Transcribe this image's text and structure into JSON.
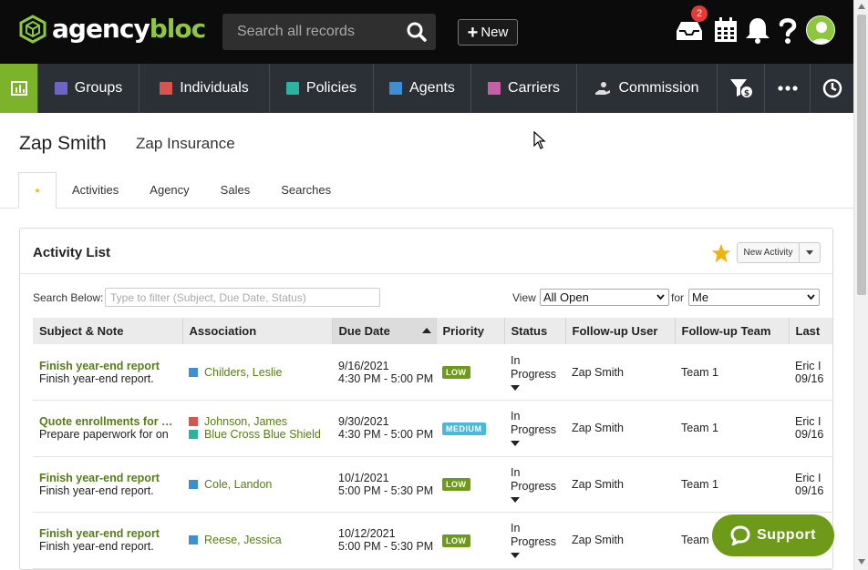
{
  "brand": {
    "name_part1": "agency",
    "name_part2": "bloc",
    "accent": "#8dc63f"
  },
  "topbar": {
    "search_placeholder": "Search all records",
    "new_label": "New",
    "inbox_count": "2",
    "icons": [
      "inbox-icon",
      "calendar-icon",
      "bell-icon",
      "help-icon",
      "user-avatar"
    ]
  },
  "nav": {
    "items": [
      {
        "label": "Groups",
        "color": "#6e63c7"
      },
      {
        "label": "Individuals",
        "color": "#d9534f"
      },
      {
        "label": "Policies",
        "color": "#2bb3a0"
      },
      {
        "label": "Agents",
        "color": "#3d8fd1"
      },
      {
        "label": "Carriers",
        "color": "#c65fa6"
      },
      {
        "label": "Commission",
        "color": "#cfcfcf"
      }
    ]
  },
  "record": {
    "name": "Zap Smith",
    "company": "Zap Insurance"
  },
  "tabs": [
    "Activities",
    "Agency",
    "Sales",
    "Searches"
  ],
  "activity": {
    "title": "Activity List",
    "new_activity": "New Activity",
    "search_label": "Search Below:",
    "filter_placeholder": "Type to filter (Subject, Due Date, Status)",
    "view_label": "View",
    "view_value": "All Open",
    "for_label": "for",
    "for_value": "Me",
    "columns": [
      "Subject & Note",
      "Association",
      "Due Date",
      "Priority",
      "Status",
      "Follow-up User",
      "Follow-up Team",
      "Last"
    ],
    "rows": [
      {
        "subject": "Finish year-end report",
        "note": "Finish year-end report.",
        "assoc": [
          {
            "name": "Childers, Leslie",
            "color": "#3d8fd1"
          }
        ],
        "date": "9/16/2021",
        "time": "4:30 PM - 5:00 PM",
        "priority": "LOW",
        "priority_color": "#6e9a1a",
        "status1": "In",
        "status2": "Progress",
        "user": "Zap Smith",
        "team": "Team 1",
        "last1": "Eric I",
        "last2": "09/16"
      },
      {
        "subject": "Quote enrollments for Blue Cross",
        "note": "Prepare paperwork for on",
        "assoc": [
          {
            "name": "Johnson, James",
            "color": "#d9534f"
          },
          {
            "name": "Blue Cross Blue Shield",
            "color": "#2bb3a0"
          }
        ],
        "date": "9/30/2021",
        "time": "4:30 PM - 5:00 PM",
        "priority": "MEDIUM",
        "priority_color": "#4ab8db",
        "status1": "In",
        "status2": "Progress",
        "user": "Zap Smith",
        "team": "Team 1",
        "last1": "Eric I",
        "last2": "09/16"
      },
      {
        "subject": "Finish year-end report",
        "note": "Finish year-end report.",
        "assoc": [
          {
            "name": "Cole, Landon",
            "color": "#3d8fd1"
          }
        ],
        "date": "10/1/2021",
        "time": "5:00 PM - 5:30 PM",
        "priority": "LOW",
        "priority_color": "#6e9a1a",
        "status1": "In",
        "status2": "Progress",
        "user": "Zap Smith",
        "team": "Team 1",
        "last1": "Eric I",
        "last2": "09/16"
      },
      {
        "subject": "Finish year-end report",
        "note": "Finish year-end report.",
        "assoc": [
          {
            "name": "Reese, Jessica",
            "color": "#3d8fd1"
          }
        ],
        "date": "10/12/2021",
        "time": "5:00 PM - 5:30 PM",
        "priority": "LOW",
        "priority_color": "#6e9a1a",
        "status1": "In",
        "status2": "Progress",
        "user": "Zap Smith",
        "team": "Team",
        "last1": "",
        "last2": ""
      }
    ]
  },
  "support_label": "Support"
}
